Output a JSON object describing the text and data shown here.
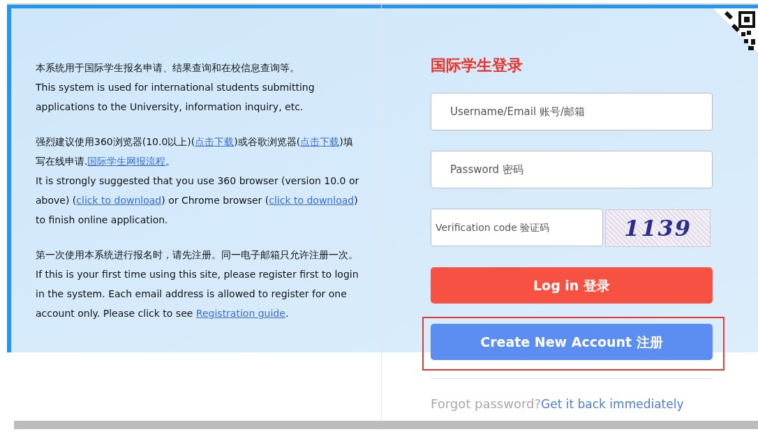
{
  "intro": [
    {
      "paragraphs": [
        [
          {
            "kind": "text",
            "text": "本系统用于国际学生报名申请、结果查询和在校信息查询等。"
          }
        ],
        [
          {
            "kind": "text",
            "text": "This system is used for international students submitting applications to the University, information inquiry, etc."
          }
        ]
      ]
    },
    {
      "paragraphs": [
        [
          {
            "kind": "text",
            "text": "强烈建议使用360浏览器(10.0以上)("
          },
          {
            "kind": "link",
            "text": "点击下载"
          },
          {
            "kind": "text",
            "text": ")或谷歌浏览器("
          },
          {
            "kind": "link",
            "text": "点击下载"
          },
          {
            "kind": "text",
            "text": ")填写在线申请."
          },
          {
            "kind": "link",
            "text": "国际学生网报流程"
          },
          {
            "kind": "text",
            "text": "。"
          }
        ],
        [
          {
            "kind": "text",
            "text": "It is strongly suggested that you use 360 browser (version 10.0 or above) ("
          },
          {
            "kind": "link",
            "text": "click to download"
          },
          {
            "kind": "text",
            "text": ") or Chrome browser ("
          },
          {
            "kind": "link",
            "text": "click to download"
          },
          {
            "kind": "text",
            "text": ") to finish online application."
          }
        ]
      ]
    },
    {
      "paragraphs": [
        [
          {
            "kind": "text",
            "text": "第一次使用本系统进行报名时，请先注册。同一电子邮箱只允许注册一次。"
          }
        ],
        [
          {
            "kind": "text",
            "text": "If this is your first time using this site, please register first to login in the system. Each email address is allowed to register for one account only. Please click to see "
          },
          {
            "kind": "link",
            "text": "Registration guide"
          },
          {
            "kind": "text",
            "text": "."
          }
        ]
      ]
    }
  ],
  "login": {
    "title": "国际学生登录",
    "fields": [
      {
        "placeholder": "Username/Email 账号/邮箱"
      },
      {
        "placeholder": "Password 密码"
      }
    ],
    "verification": {
      "placeholder": "Verification code 验证码",
      "captcha": "1139"
    },
    "buttons": [
      {
        "kind": "login",
        "label": "Log in 登录",
        "highlighted": false
      },
      {
        "kind": "register",
        "label": "Create New Account 注册",
        "highlighted": true
      }
    ],
    "forgot": {
      "text": "Forgot password?",
      "link": "Get it back immediately"
    }
  }
}
